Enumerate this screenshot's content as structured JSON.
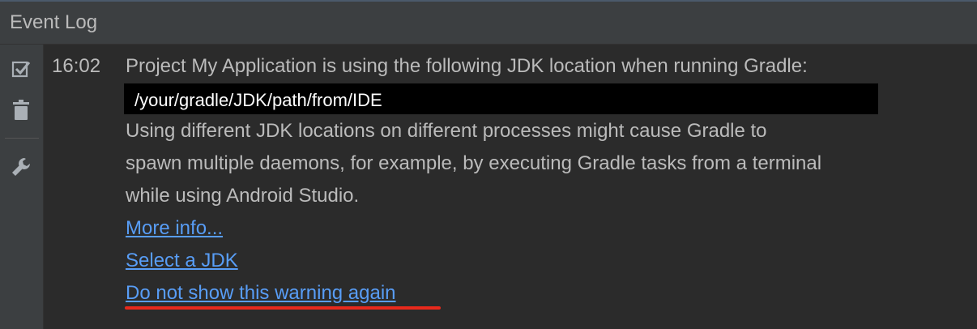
{
  "panel": {
    "title": "Event Log"
  },
  "toolbar": {
    "items": [
      {
        "icon": "mark-all-read-icon"
      },
      {
        "icon": "trash-icon"
      },
      {
        "icon": "wrench-icon"
      }
    ]
  },
  "event": {
    "time": "16:02",
    "lines": [
      "Project My Application is using the following JDK location when running Gradle:"
    ],
    "path": "/your/gradle/JDK/path/from/IDE",
    "body": [
      "Using different JDK locations on different processes might cause Gradle to",
      "spawn multiple daemons, for example, by executing Gradle tasks from a terminal",
      "while using Android Studio."
    ],
    "links": [
      "More info...",
      "Select a JDK",
      "Do not show this warning again"
    ]
  },
  "colors": {
    "link": "#589df6",
    "highlight": "#e8291c",
    "text": "#bbbbbb"
  }
}
